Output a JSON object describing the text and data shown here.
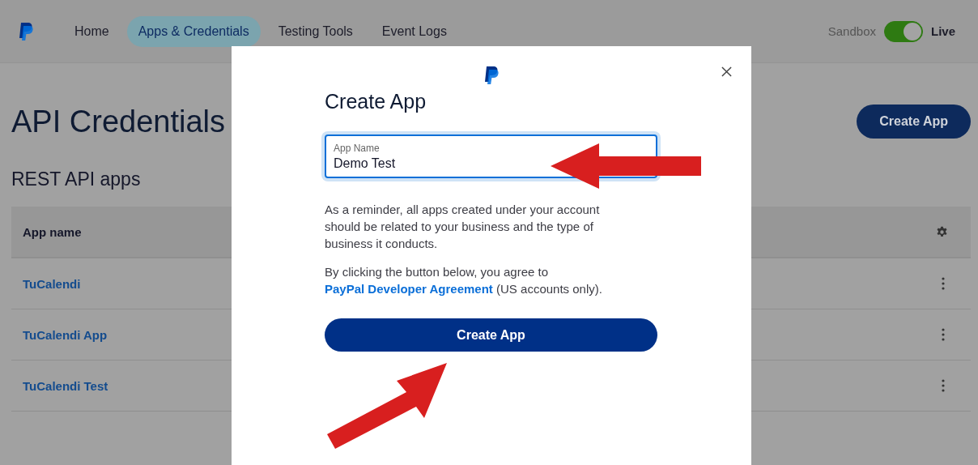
{
  "nav": {
    "items": [
      {
        "label": "Home",
        "selected": false
      },
      {
        "label": "Apps & Credentials",
        "selected": true
      },
      {
        "label": "Testing Tools",
        "selected": false
      },
      {
        "label": "Event Logs",
        "selected": false
      }
    ],
    "environment": {
      "left_label": "Sandbox",
      "right_label": "Live",
      "on": true
    }
  },
  "page": {
    "title": "API Credentials",
    "create_button": "Create App",
    "section_title": "REST API apps",
    "table": {
      "columns": [
        "App name"
      ],
      "rows": [
        {
          "name": "TuCalendi"
        },
        {
          "name": "TuCalendi App"
        },
        {
          "name": "TuCalendi Test"
        }
      ]
    }
  },
  "modal": {
    "title": "Create App",
    "field": {
      "label": "App Name",
      "value": "Demo Test",
      "focused": true
    },
    "reminder": "As a reminder, all apps created under your account should be related to your business and the type of business it conducts.",
    "agreement": {
      "before": "By clicking the button below, you agree to",
      "link": "PayPal Developer Agreement",
      "after": "(US accounts only)."
    },
    "button": "Create App"
  }
}
